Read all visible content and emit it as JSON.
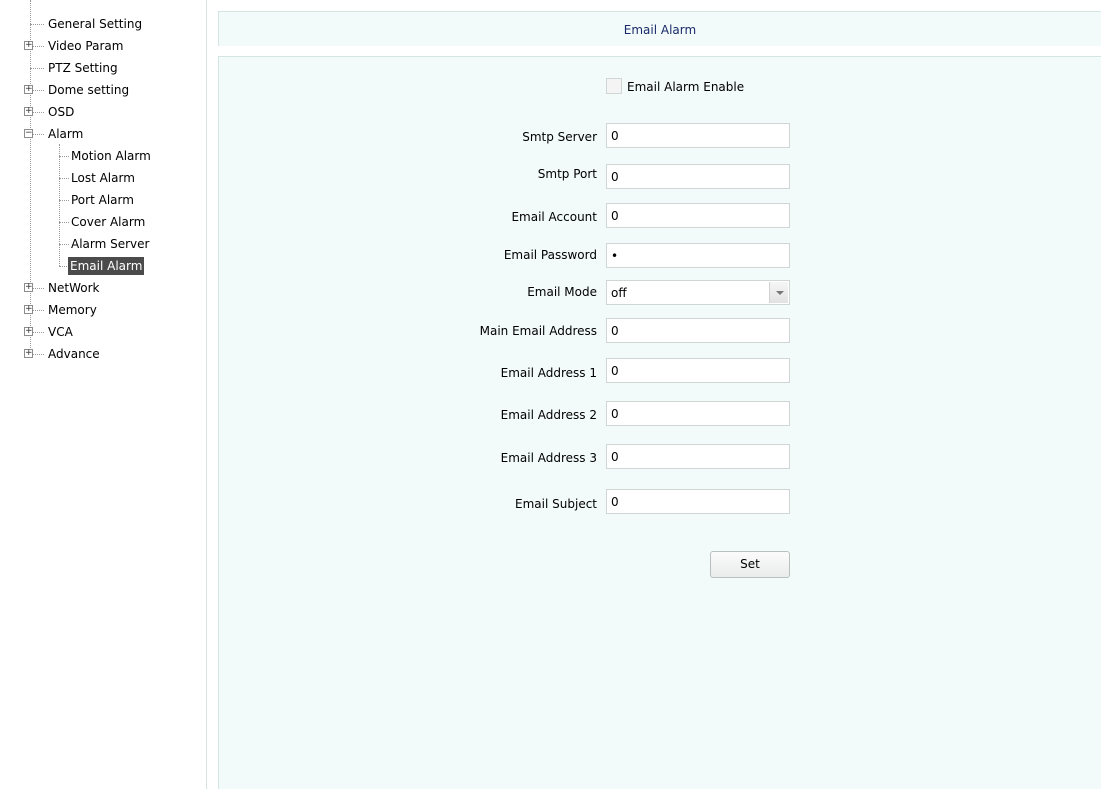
{
  "sidebar": {
    "items": [
      {
        "label": "General Setting",
        "expander": ""
      },
      {
        "label": "Video Param",
        "expander": "+"
      },
      {
        "label": "PTZ Setting",
        "expander": ""
      },
      {
        "label": "Dome setting",
        "expander": "+"
      },
      {
        "label": "OSD",
        "expander": "+"
      },
      {
        "label": "Alarm",
        "expander": "−"
      },
      {
        "label": "Motion Alarm",
        "expander": ""
      },
      {
        "label": "Lost Alarm",
        "expander": ""
      },
      {
        "label": "Port Alarm",
        "expander": ""
      },
      {
        "label": "Cover Alarm",
        "expander": ""
      },
      {
        "label": "Alarm Server",
        "expander": ""
      },
      {
        "label": "Email Alarm",
        "expander": "",
        "selected": true
      },
      {
        "label": "NetWork",
        "expander": "+"
      },
      {
        "label": "Memory",
        "expander": "+"
      },
      {
        "label": "VCA",
        "expander": "+"
      },
      {
        "label": "Advance",
        "expander": "+"
      }
    ]
  },
  "header": {
    "title": "Email Alarm"
  },
  "form": {
    "enable": {
      "label": "Email Alarm Enable",
      "checked": false
    },
    "smtp_server": {
      "label": "Smtp Server",
      "value": "0"
    },
    "smtp_port": {
      "label": "Smtp Port",
      "value": "0"
    },
    "email_account": {
      "label": "Email Account",
      "value": "0"
    },
    "email_password": {
      "label": "Email Password",
      "value": "•"
    },
    "email_mode": {
      "label": "Email Mode",
      "value": "off"
    },
    "main_email_address": {
      "label": "Main Email Address",
      "value": "0"
    },
    "email_address_1": {
      "label": "Email Address 1",
      "value": "0"
    },
    "email_address_2": {
      "label": "Email Address 2",
      "value": "0"
    },
    "email_address_3": {
      "label": "Email Address 3",
      "value": "0"
    },
    "email_subject": {
      "label": "Email Subject",
      "value": "0"
    },
    "set_label": "Set"
  },
  "colors": {
    "content_bg": "#f2fbf9",
    "header_text": "#1a2a6a",
    "selected_bg": "#4b4b4b"
  }
}
